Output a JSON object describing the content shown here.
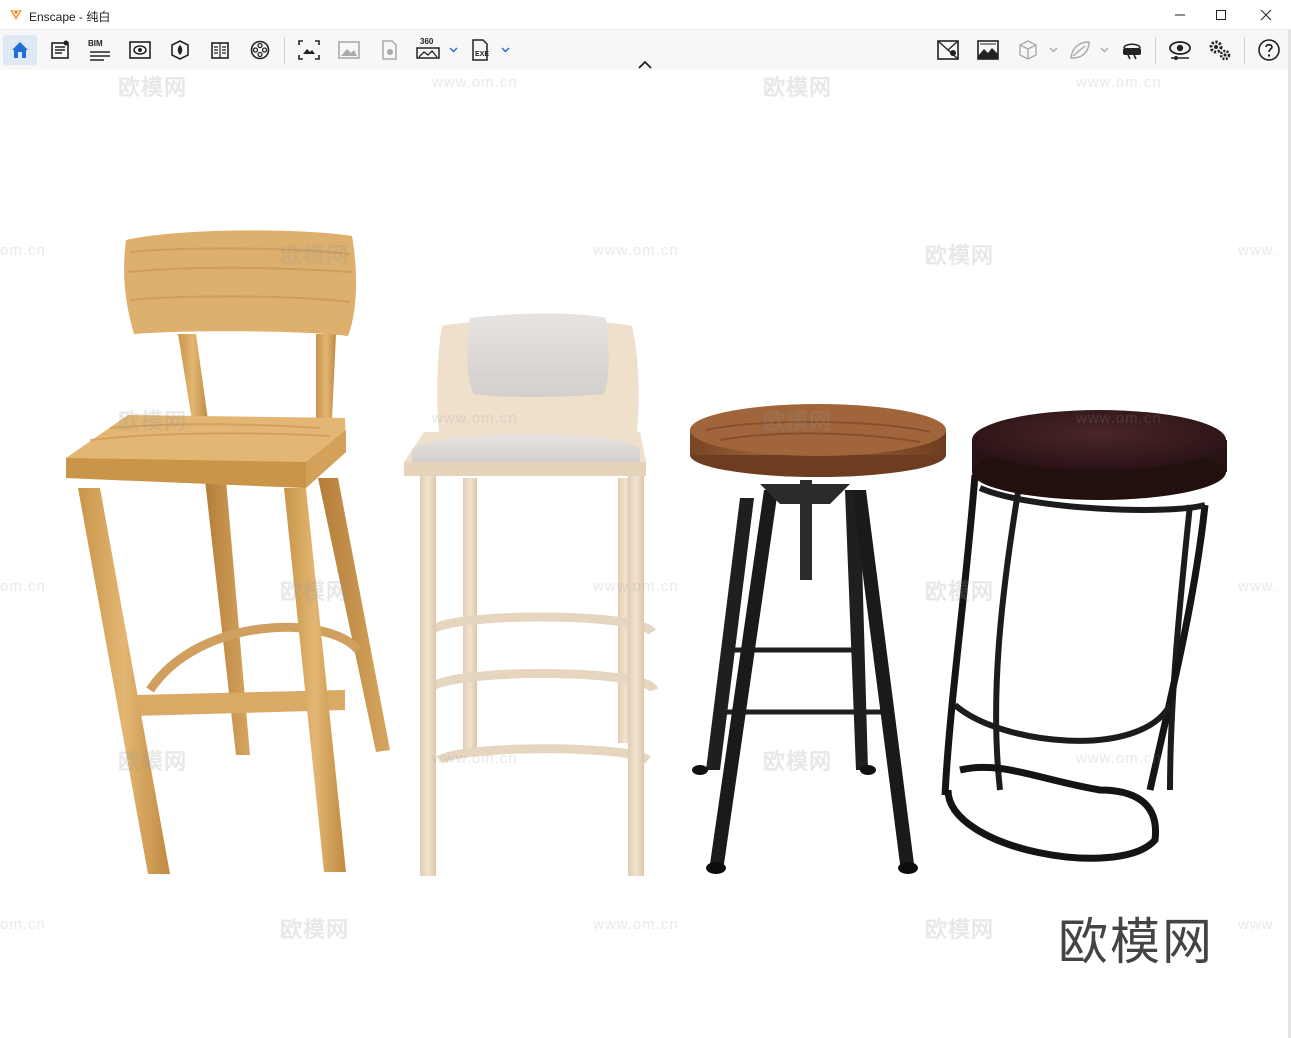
{
  "window": {
    "title": "Enscape - 纯白",
    "controls": {
      "minimize": "minimize-icon",
      "maximize": "maximize-icon",
      "close": "close-icon"
    }
  },
  "toolbar": {
    "left_tools": [
      {
        "icon": "home-icon",
        "active": true
      },
      {
        "icon": "notes-icon"
      },
      {
        "icon": "bim-icon",
        "label": "BIM"
      },
      {
        "icon": "eye-view-icon"
      },
      {
        "icon": "asset-library-icon"
      },
      {
        "icon": "book-icon"
      },
      {
        "icon": "video-reel-icon"
      },
      {
        "icon": "screenshot-icon"
      },
      {
        "icon": "image-icon"
      },
      {
        "icon": "render-file-icon"
      },
      {
        "icon": "panorama-360-icon",
        "label": "360"
      },
      {
        "icon": "exe-export-icon",
        "label": "EXE"
      }
    ],
    "right_tools": [
      {
        "icon": "map-pin-icon"
      },
      {
        "icon": "landscape-frame-icon"
      },
      {
        "icon": "cube-icon"
      },
      {
        "icon": "leaf-icon"
      },
      {
        "icon": "vr-headset-icon"
      },
      {
        "icon": "visual-settings-icon"
      },
      {
        "icon": "settings-gears-icon"
      },
      {
        "icon": "help-icon"
      }
    ]
  },
  "watermark": {
    "brand": "欧模网",
    "url": "www.om.cn",
    "url_partial": "om.cn",
    "url_cut": "www."
  },
  "scene": {
    "objects": [
      "wooden-bar-chair",
      "cushioned-bar-chair",
      "swivel-wood-stool",
      "leather-bar-stool"
    ],
    "colors": {
      "oak": "#d7a862",
      "pale_wood": "#ecdcc4",
      "fabric": "#dedad6",
      "walnut": "#8e5632",
      "metal": "#1f1f1f",
      "leather": "#3c1d1f"
    }
  }
}
